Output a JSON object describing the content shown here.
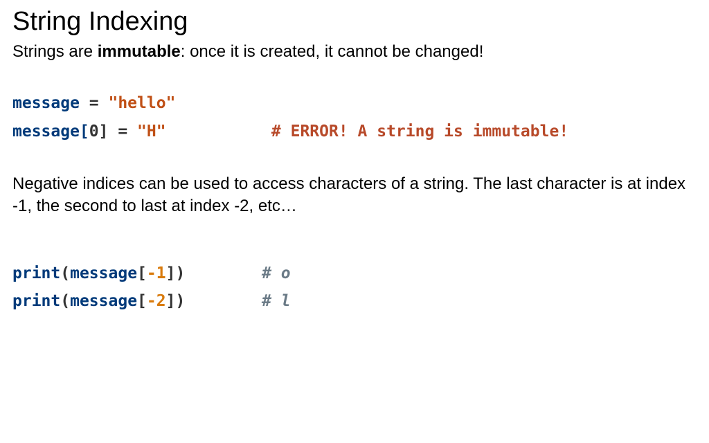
{
  "title": "String Indexing",
  "intro": {
    "prefix": "Strings are ",
    "bold": "immutable",
    "suffix": ": once it is created, it cannot be changed!"
  },
  "code1": {
    "l1": {
      "id": "message",
      "eq": " = ",
      "str": "\"hello\""
    },
    "l2": {
      "id": "message[",
      "idx": "0",
      "close": "] = ",
      "str": "\"H\"",
      "pad": "           ",
      "comment": "# ERROR! A string is immutable!"
    }
  },
  "para2": "Negative indices can be used to access characters of a string. The last character is at index -1, the second to last at index -2, etc…",
  "code2": {
    "l1": {
      "fn": "print",
      "open": "(",
      "id": "message",
      "br_open": "[",
      "idx": "-1",
      "br_close": "]",
      "close": ")",
      "pad": "        ",
      "comment": "# o"
    },
    "l2": {
      "fn": "print",
      "open": "(",
      "id": "message",
      "br_open": "[",
      "idx": "-2",
      "br_close": "]",
      "close": ")",
      "pad": "        ",
      "comment": "# l"
    }
  }
}
